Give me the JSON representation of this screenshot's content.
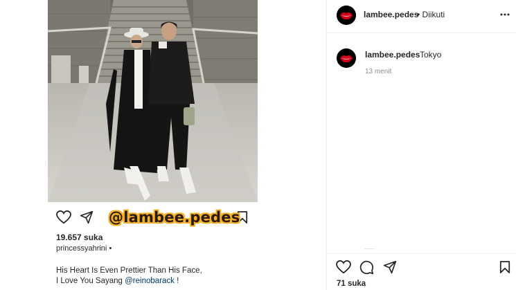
{
  "embedded_post": {
    "watermark": "@lambee.pedes",
    "likes": "19.657 suka",
    "username": "princessyahrini",
    "username_separator": "•",
    "caption_line1": "His Heart Is Even Prettier Than His Face,",
    "caption_line2_prefix": "I Love You Sayang ",
    "caption_mention": "@reinobarack",
    "caption_line2_suffix": " !"
  },
  "header": {
    "username": "lambee.pedes",
    "follow_status": "• Diikuti"
  },
  "caption": {
    "username": "lambee.pedes",
    "text": "Tokyo",
    "timestamp": "13 menit"
  },
  "action_bar": {
    "likes": "71 suka"
  },
  "icons": {
    "like": "heart-icon",
    "comment": "comment-icon",
    "share": "share-icon",
    "save": "bookmark-icon",
    "more": "more-horizontal-icon"
  },
  "colors": {
    "watermark_fill": "#2b1a0d",
    "watermark_outline": "#f1b12d",
    "mention": "#00376b",
    "muted": "#8e8e8e",
    "avatar_red": "#d0021b"
  }
}
